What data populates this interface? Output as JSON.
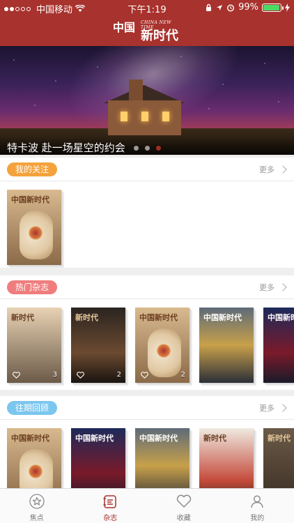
{
  "status_bar": {
    "carrier": "中国移动",
    "time": "下午1:19",
    "battery": "99%",
    "battery_level": 0.99
  },
  "header": {
    "logo_cn_top": "中国",
    "logo_en": "CHINA NEW TIME",
    "logo_cn_bottom": "新时代"
  },
  "banner": {
    "title": "特卡波 赴一场星空的约会",
    "page_count": 3,
    "active_page": 3
  },
  "sections": {
    "following": {
      "label": "我的关注",
      "more": "更多",
      "items": [
        {
          "cover": "vase",
          "masthead": "中国新时代"
        }
      ]
    },
    "hot": {
      "label": "热门杂志",
      "more": "更多",
      "items": [
        {
          "cover": "tea",
          "masthead": "新时代",
          "likes": "3"
        },
        {
          "cover": "pottery",
          "masthead": "新时代",
          "likes": "2"
        },
        {
          "cover": "vase",
          "masthead": "中国新时代",
          "likes": "2"
        },
        {
          "cover": "runners",
          "masthead": "中国新时代",
          "likes": ""
        },
        {
          "cover": "night",
          "masthead": "中国新时代",
          "likes": ""
        }
      ]
    },
    "archive": {
      "label": "往期回顾",
      "more": "更多",
      "items": [
        {
          "cover": "vase",
          "masthead": "中国新时代"
        },
        {
          "cover": "night",
          "masthead": "中国新时代"
        },
        {
          "cover": "runners",
          "masthead": "中国新时代"
        },
        {
          "cover": "family",
          "masthead": "新时代"
        },
        {
          "cover": "lock",
          "masthead": "新时代"
        }
      ]
    }
  },
  "tabbar": {
    "items": [
      {
        "label": "焦点",
        "icon": "star-icon"
      },
      {
        "label": "杂志",
        "icon": "magazine-icon"
      },
      {
        "label": "收藏",
        "icon": "heart-icon"
      },
      {
        "label": "我的",
        "icon": "person-icon"
      }
    ],
    "active_index": 1
  },
  "colors": {
    "brand": "#a8322d",
    "following_pill": "#f4a23c",
    "hot_pill": "#f07d7d",
    "archive_pill": "#7bc6ee"
  }
}
